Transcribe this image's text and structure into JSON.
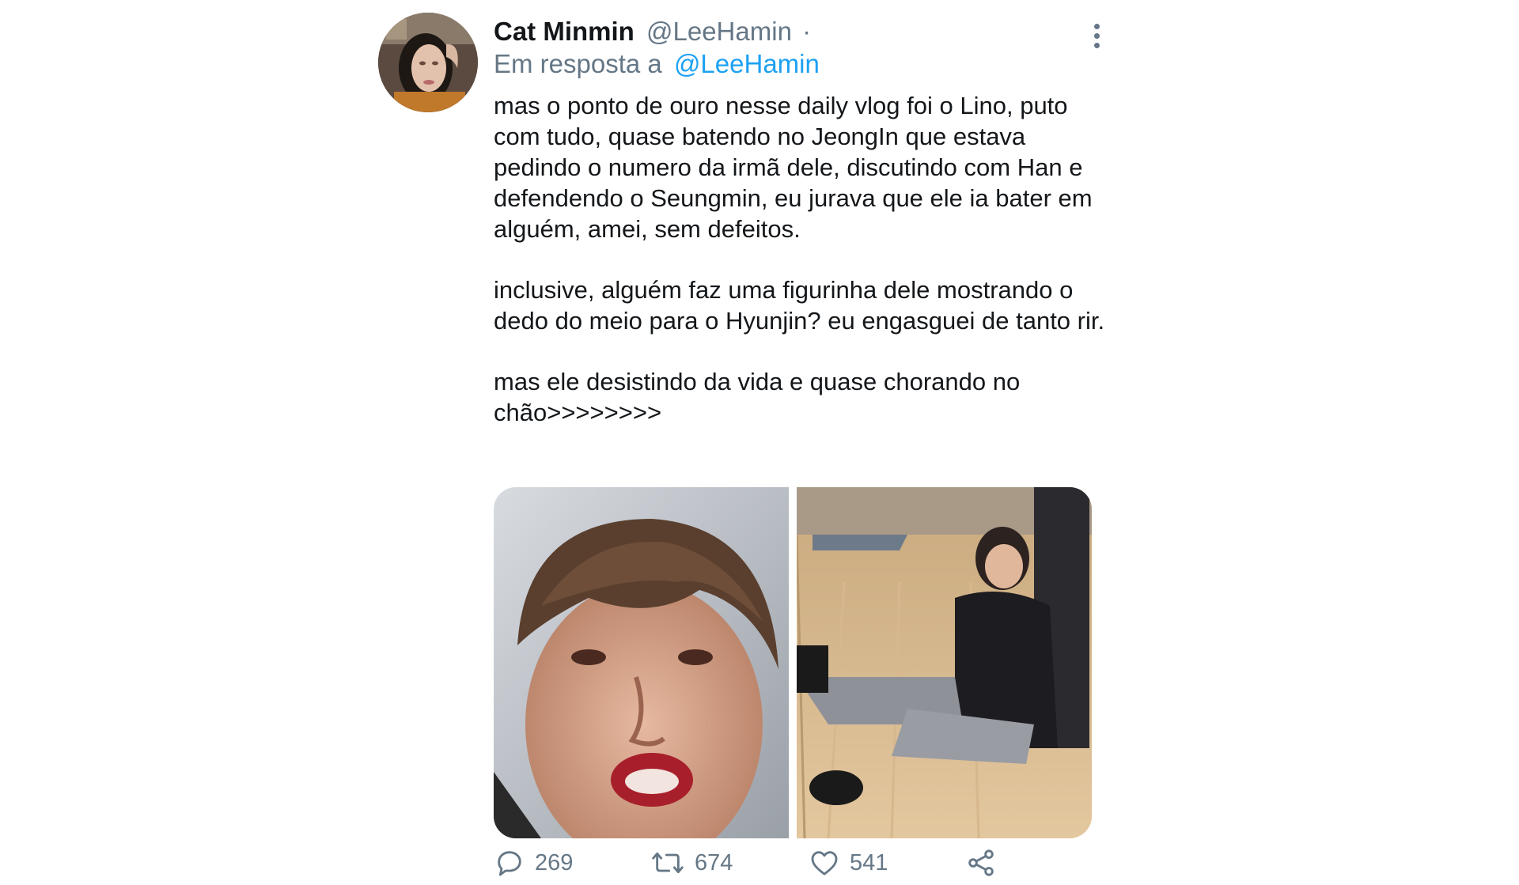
{
  "tweet": {
    "author": {
      "display_name": "Cat Minmin",
      "handle": "@LeeHamin",
      "separator": "·"
    },
    "reply_to": {
      "prefix": "Em resposta a",
      "handle": "@LeeHamin"
    },
    "text": {
      "paragraph_1": "mas o ponto de ouro nesse daily vlog foi o Lino, puto com tudo, quase batendo no JeongIn que estava pedindo o numero da irmã dele, discutindo com Han e defendendo o Seungmin, eu jurava que ele ia bater em alguém, amei, sem defeitos.",
      "paragraph_2": "inclusive, alguém faz uma figurinha dele mostrando o dedo do meio para o Hyunjin? eu engasguei de tanto rir.",
      "paragraph_3": "mas ele desistindo da vida e quase chorando no chão>>>>>>>>"
    },
    "media": [
      {
        "icon": "photo-close-up-face"
      },
      {
        "icon": "photo-sitting-on-floor"
      }
    ],
    "actions": {
      "replies": "269",
      "retweets": "674",
      "likes": "541"
    },
    "icons": {
      "more": "more-vertical-icon",
      "reply": "reply-bubble-icon",
      "retweet": "retweet-arrows-icon",
      "like": "heart-icon",
      "share": "share-icon"
    },
    "colors": {
      "text": "#14171a",
      "secondary": "#657786",
      "link": "#1da1f2"
    }
  }
}
